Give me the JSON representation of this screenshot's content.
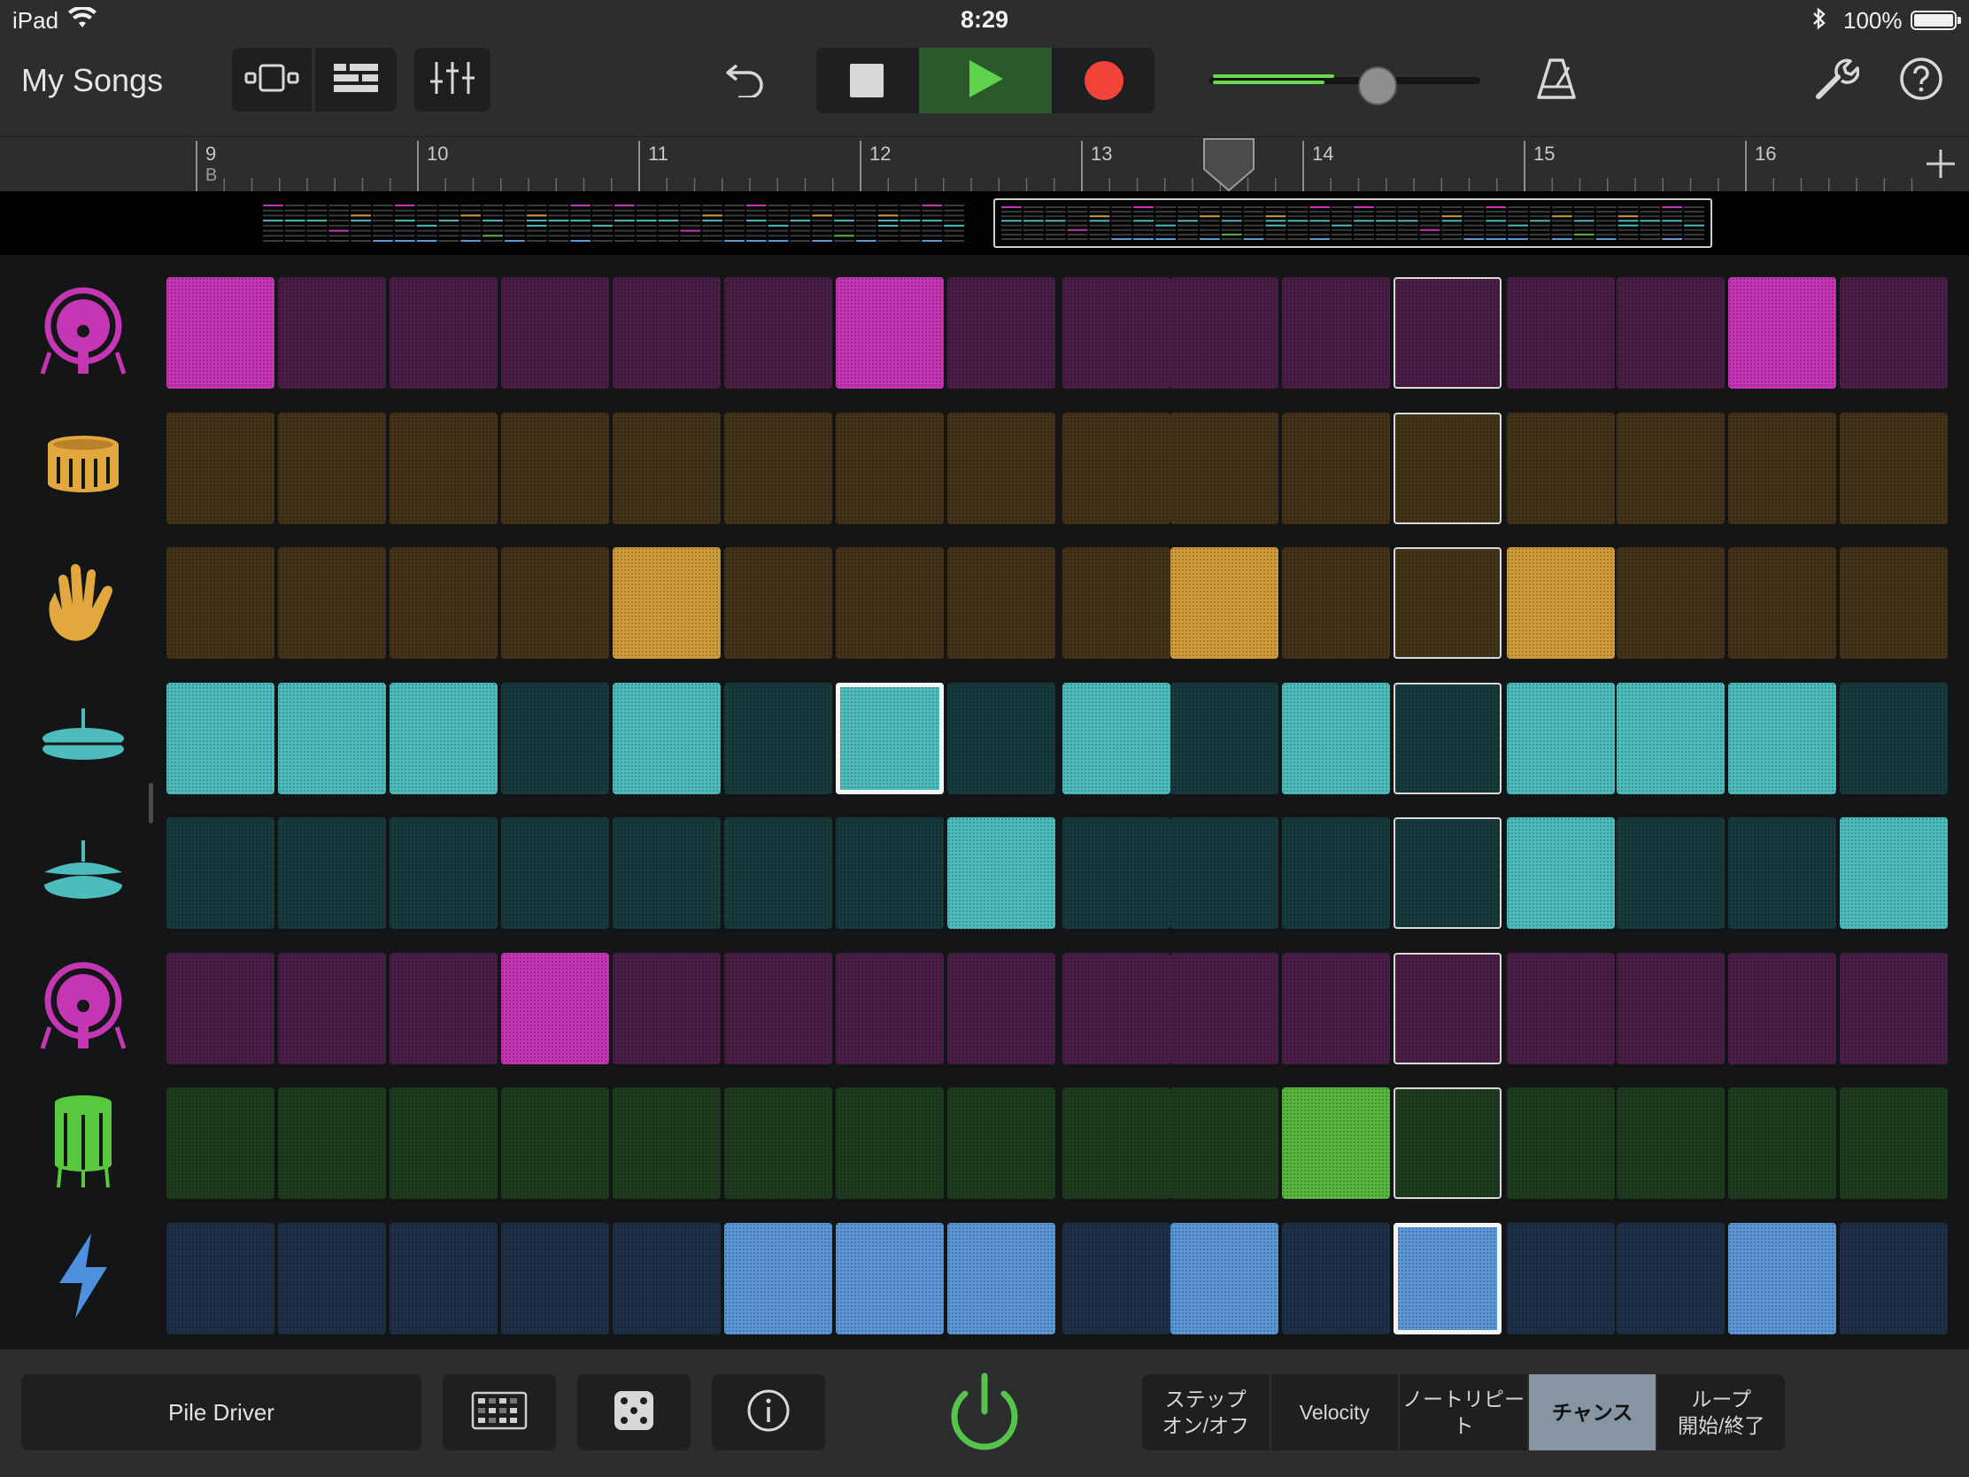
{
  "status_bar": {
    "device": "iPad",
    "time": "8:29",
    "battery": "100%",
    "icons": [
      "wifi-icon",
      "bluetooth-icon",
      "battery-icon"
    ]
  },
  "control_bar": {
    "my_songs": "My Songs",
    "icons": [
      "tracks-view-icon",
      "track-list-icon",
      "mixer-icon",
      "undo-icon",
      "stop-icon",
      "play-icon",
      "record-icon",
      "metronome-icon",
      "settings-icon",
      "help-icon"
    ],
    "master_volume_fraction": 0.62
  },
  "ruler": {
    "bars": [
      "9",
      "10",
      "11",
      "12",
      "13",
      "14",
      "15",
      "16"
    ],
    "section_label": "B",
    "playhead_bar": "13.7"
  },
  "rows": [
    {
      "instrument": "kick-drum",
      "icon": "kick-drum-icon",
      "color_on": "#c536b5",
      "color_off": "#4a1d45",
      "steps": [
        1,
        0,
        0,
        0,
        0,
        0,
        1,
        0,
        0,
        0,
        0,
        0,
        0,
        0,
        1,
        0
      ]
    },
    {
      "instrument": "snare",
      "icon": "snare-drum-icon",
      "color_on": "#d09c3b",
      "color_off": "#433319",
      "steps": [
        0,
        0,
        0,
        0,
        0,
        0,
        0,
        0,
        0,
        0,
        0,
        0,
        0,
        0,
        0,
        0
      ]
    },
    {
      "instrument": "clap",
      "icon": "clap-hand-icon",
      "color_on": "#d09c3b",
      "color_off": "#433319",
      "steps": [
        0,
        0,
        0,
        0,
        1,
        0,
        0,
        0,
        0,
        1,
        0,
        0,
        1,
        0,
        0,
        0
      ]
    },
    {
      "instrument": "closed-hihat",
      "icon": "closed-hihat-icon",
      "color_on": "#4dbcbd",
      "color_off": "#173a3d",
      "steps": [
        1,
        1,
        1,
        0,
        1,
        0,
        1,
        0,
        1,
        0,
        1,
        0,
        1,
        1,
        1,
        0
      ]
    },
    {
      "instrument": "open-hihat",
      "icon": "open-hihat-icon",
      "color_on": "#4dbcbd",
      "color_off": "#173a3d",
      "steps": [
        0,
        0,
        0,
        0,
        0,
        0,
        0,
        1,
        0,
        0,
        0,
        0,
        1,
        0,
        0,
        1
      ]
    },
    {
      "instrument": "kick-drum-2",
      "icon": "kick-drum-icon",
      "color_on": "#c536b5",
      "color_off": "#4a1d45",
      "steps": [
        0,
        0,
        0,
        1,
        0,
        0,
        0,
        0,
        0,
        0,
        0,
        0,
        0,
        0,
        0,
        0
      ]
    },
    {
      "instrument": "floor-tom",
      "icon": "floor-tom-icon",
      "color_on": "#58b73c",
      "color_off": "#1f3b1f",
      "steps": [
        0,
        0,
        0,
        0,
        0,
        0,
        0,
        0,
        0,
        0,
        1,
        0,
        0,
        0,
        0,
        0
      ]
    },
    {
      "instrument": "fx",
      "icon": "lightning-icon",
      "color_on": "#5b96d6",
      "color_off": "#1d3048",
      "steps": [
        0,
        0,
        0,
        0,
        0,
        1,
        1,
        1,
        0,
        1,
        0,
        1,
        0,
        0,
        1,
        0
      ]
    }
  ],
  "bottom_bar": {
    "pattern_name": "Pile Driver",
    "icons": [
      "pattern-grid-icon",
      "dice-icon",
      "info-icon",
      "power-icon"
    ],
    "modes": [
      "ステップ\nオン/オフ",
      "Velocity",
      "ノートリピート",
      "チャンス",
      "ループ\n開始/終了"
    ],
    "active_mode": "チャンス"
  },
  "colors": {
    "background": "#151617",
    "toolbar": "#2c2d2f",
    "accent_green": "#56c44a",
    "record_red": "#f0443a",
    "active_mode": "#8795a3"
  }
}
